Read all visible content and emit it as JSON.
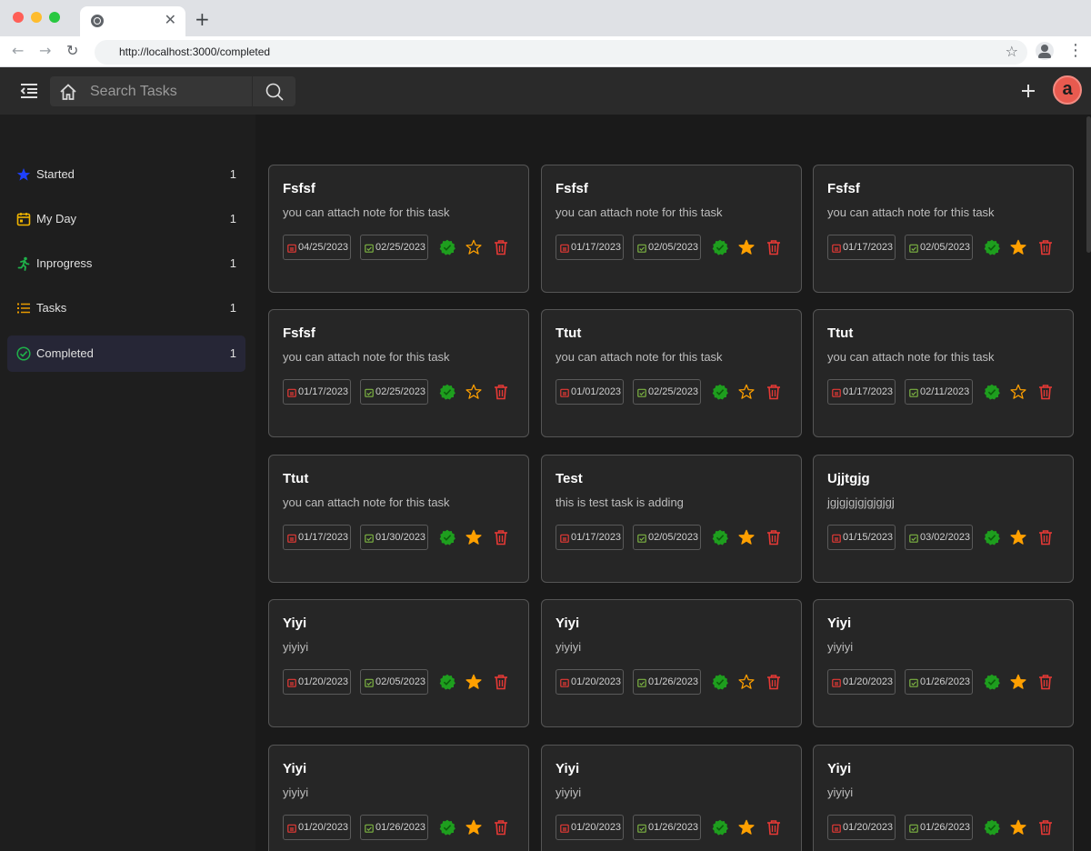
{
  "browser": {
    "url": "http://localhost:3000/completed",
    "tab_close": "✕",
    "new_tab": "+"
  },
  "header": {
    "search_placeholder": "Search Tasks",
    "avatar_letter": "a"
  },
  "sidebar": {
    "items": [
      {
        "label": "Started",
        "count": "1",
        "icon": "star-icon"
      },
      {
        "label": "My Day",
        "count": "1",
        "icon": "calendar-icon"
      },
      {
        "label": "Inprogress",
        "count": "1",
        "icon": "running-icon"
      },
      {
        "label": "Tasks",
        "count": "1",
        "icon": "list-icon"
      },
      {
        "label": "Completed",
        "count": "1",
        "icon": "check-circle-icon",
        "active": true
      }
    ]
  },
  "colors": {
    "start_date": "#e53935",
    "due_date": "#7cb342",
    "check": "#1e9e1e",
    "star": "#ffa000",
    "delete": "#e53935",
    "avatar": "#e85a4f"
  },
  "tasks": [
    {
      "title": "Fsfsf",
      "note": "you can attach note for this task",
      "start": "04/25/2023",
      "due": "02/25/2023",
      "starred": false
    },
    {
      "title": "Fsfsf",
      "note": "you can attach note for this task",
      "start": "01/17/2023",
      "due": "02/05/2023",
      "starred": true
    },
    {
      "title": "Fsfsf",
      "note": "you can attach note for this task",
      "start": "01/17/2023",
      "due": "02/05/2023",
      "starred": true
    },
    {
      "title": "Fsfsf",
      "note": "you can attach note for this task",
      "start": "01/17/2023",
      "due": "02/25/2023",
      "starred": false
    },
    {
      "title": "Ttut",
      "note": "you can attach note for this task",
      "start": "01/01/2023",
      "due": "02/25/2023",
      "starred": false
    },
    {
      "title": "Ttut",
      "note": "you can attach note for this task",
      "start": "01/17/2023",
      "due": "02/11/2023",
      "starred": false
    },
    {
      "title": "Ttut",
      "note": "you can attach note for this task",
      "start": "01/17/2023",
      "due": "01/30/2023",
      "starred": true
    },
    {
      "title": "Test",
      "note": "this is test task is adding",
      "start": "01/17/2023",
      "due": "02/05/2023",
      "starred": true
    },
    {
      "title": "Ujjtgjg",
      "note": "jgjgjgjgjgjgjgj",
      "start": "01/15/2023",
      "due": "03/02/2023",
      "starred": true
    },
    {
      "title": "Yiyi",
      "note": "yiyiyi",
      "start": "01/20/2023",
      "due": "02/05/2023",
      "starred": true
    },
    {
      "title": "Yiyi",
      "note": "yiyiyi",
      "start": "01/20/2023",
      "due": "01/26/2023",
      "starred": false
    },
    {
      "title": "Yiyi",
      "note": "yiyiyi",
      "start": "01/20/2023",
      "due": "01/26/2023",
      "starred": true
    },
    {
      "title": "Yiyi",
      "note": "yiyiyi",
      "start": "01/20/2023",
      "due": "01/26/2023",
      "starred": true
    },
    {
      "title": "Yiyi",
      "note": "yiyiyi",
      "start": "01/20/2023",
      "due": "01/26/2023",
      "starred": true
    },
    {
      "title": "Yiyi",
      "note": "yiyiyi",
      "start": "01/20/2023",
      "due": "01/26/2023",
      "starred": true
    }
  ]
}
